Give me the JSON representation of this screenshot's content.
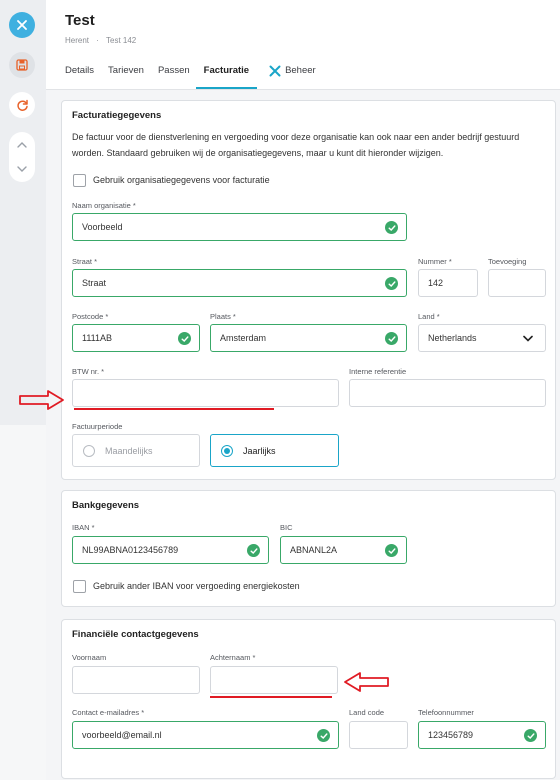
{
  "header": {
    "title": "Test",
    "breadcrumb": [
      "Herent",
      "Test 142"
    ]
  },
  "tabs": [
    {
      "label": "Details",
      "active": false
    },
    {
      "label": "Tarieven",
      "active": false
    },
    {
      "label": "Passen",
      "active": false
    },
    {
      "label": "Facturatie",
      "active": true
    },
    {
      "label": "Beheer",
      "active": false
    }
  ],
  "rail": {
    "icons": [
      "close-icon",
      "save-icon",
      "refresh-icon",
      "chevron-up-icon",
      "chevron-down-icon"
    ]
  },
  "billing": {
    "title": "Facturatiegegevens",
    "description": "De factuur voor de dienstverlening en vergoeding voor deze organisatie kan ook naar een ander bedrijf gestuurd worden. Standaard gebruiken wij de organisatiegegevens, maar u kunt dit hieronder wijzigen.",
    "use_org_checkbox": "Gebruik organisatiegegevens voor facturatie",
    "org_name_label": "Naam organisatie *",
    "org_name_value": "Voorbeeld",
    "street_label": "Straat *",
    "street_value": "Straat",
    "number_label": "Nummer *",
    "number_value": "142",
    "addition_label": "Toevoeging",
    "addition_value": "",
    "postcode_label": "Postcode *",
    "postcode_value": "1111AB",
    "city_label": "Plaats *",
    "city_value": "Amsterdam",
    "country_label": "Land *",
    "country_value": "Netherlands",
    "vat_label": "BTW nr. *",
    "vat_value": "",
    "internal_ref_label": "Interne referentie",
    "internal_ref_value": "",
    "period_label": "Factuurperiode",
    "period_options": [
      "Maandelijks",
      "Jaarlijks"
    ],
    "period_selected": "Jaarlijks"
  },
  "bank": {
    "title": "Bankgegevens",
    "iban_label": "IBAN *",
    "iban_value": "NL99ABNA0123456789",
    "bic_label": "BIC",
    "bic_value": "ABNANL2A",
    "other_iban_checkbox": "Gebruik ander IBAN voor vergoeding energiekosten"
  },
  "contact": {
    "title": "Financiële contactgegevens",
    "firstname_label": "Voornaam",
    "firstname_value": "",
    "lastname_label": "Achternaam *",
    "lastname_value": "",
    "email_label": "Contact e-mailadres *",
    "email_value": "voorbeeld@email.nl",
    "country_code_label": "Land code",
    "country_code_value": "",
    "phone_label": "Telefoonnummer",
    "phone_value": "123456789"
  },
  "colors": {
    "accent": "#1aa5c8",
    "valid": "#39a868",
    "annotation": "#e01b24",
    "save": "#e8622a"
  }
}
